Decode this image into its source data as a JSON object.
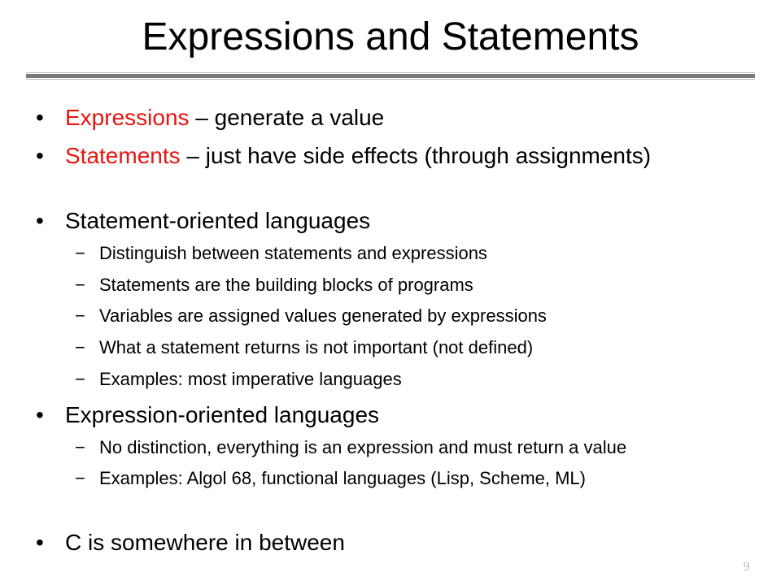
{
  "slide": {
    "title": "Expressions and Statements",
    "page_number": "9",
    "accent_color": "#e8150e",
    "bullet_glyph": "•",
    "dash_glyph": "−"
  },
  "bullets": [
    {
      "keyword": "Expressions",
      "text": " – generate a value"
    },
    {
      "keyword": "Statements",
      "text": " – just have side effects (through assignments)"
    },
    {
      "text": "Statement-oriented languages",
      "subitems": [
        "Distinguish between statements and expressions",
        "Statements are the building blocks of programs",
        "Variables are assigned values generated by expressions",
        "What a statement returns is not important (not defined)",
        "Examples: most imperative languages"
      ]
    },
    {
      "text": "Expression-oriented languages",
      "subitems": [
        "No distinction, everything is an expression and must return a value",
        "Examples: Algol 68, functional languages (Lisp, Scheme, ML)"
      ]
    },
    {
      "text": "C is somewhere in between"
    }
  ]
}
